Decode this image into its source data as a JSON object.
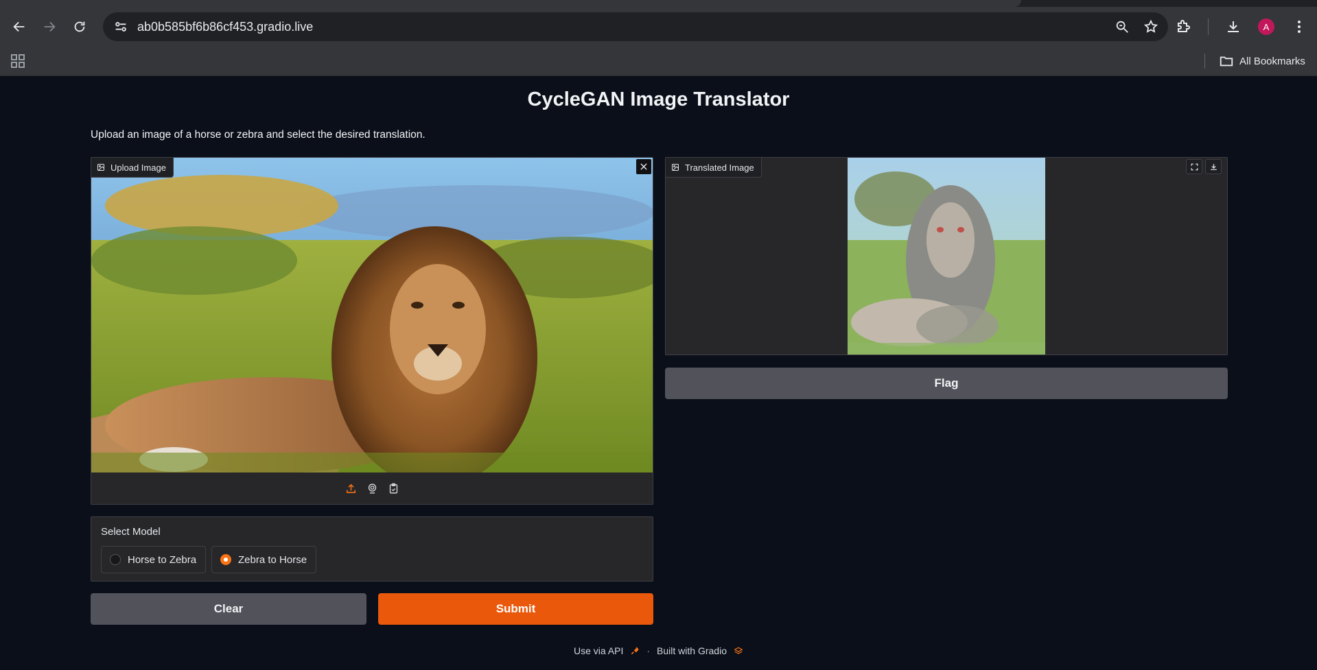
{
  "browser": {
    "url": "ab0b585bf6b86cf453.gradio.live",
    "bookmarks_label": "All Bookmarks",
    "avatar_letter": "A"
  },
  "app": {
    "title": "CycleGAN Image Translator",
    "description": "Upload an image of a horse or zebra and select the desired translation.",
    "upload_label": "Upload Image",
    "output_label": "Translated Image",
    "flag_label": "Flag",
    "model": {
      "label": "Select Model",
      "options": [
        "Horse to Zebra",
        "Zebra to Horse"
      ],
      "selected": "Zebra to Horse"
    },
    "clear_label": "Clear",
    "submit_label": "Submit"
  },
  "footer": {
    "api_label": "Use via API",
    "separator": "·",
    "built_label": "Built with Gradio"
  },
  "colors": {
    "accent": "#ea580c",
    "background": "#0b0f19",
    "panel": "#27272a"
  }
}
